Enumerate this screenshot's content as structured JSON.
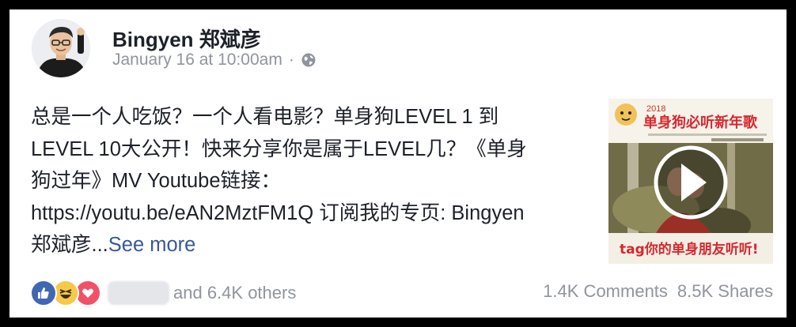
{
  "post": {
    "author": "Bingyen 郑斌彦",
    "timestamp": "January 16 at 10:00am",
    "separator": "·",
    "privacy_icon": "globe-icon",
    "text_lines": [
      "总是一个人吃饭？一个人看电影？单身狗LEVEL 1 到",
      "LEVEL 10大公开！快来分享你是属于LEVEL几？《单身",
      "狗过年》MV Youtube链接：",
      "https://youtu.be/eAN2MztFM1Q 订阅我的专页: Bingyen",
      "郑斌彦..."
    ],
    "see_more": "See more"
  },
  "thumbnail": {
    "year": "2018",
    "title": "单身狗必听新年歌",
    "footer": "tag你的单身朋友听听!",
    "play_icon": "play-icon"
  },
  "footer": {
    "reaction_icons": [
      "like-icon",
      "haha-icon",
      "love-icon"
    ],
    "others": "and 6.4K others",
    "comments": "1.4K Comments",
    "shares": "8.5K Shares"
  }
}
